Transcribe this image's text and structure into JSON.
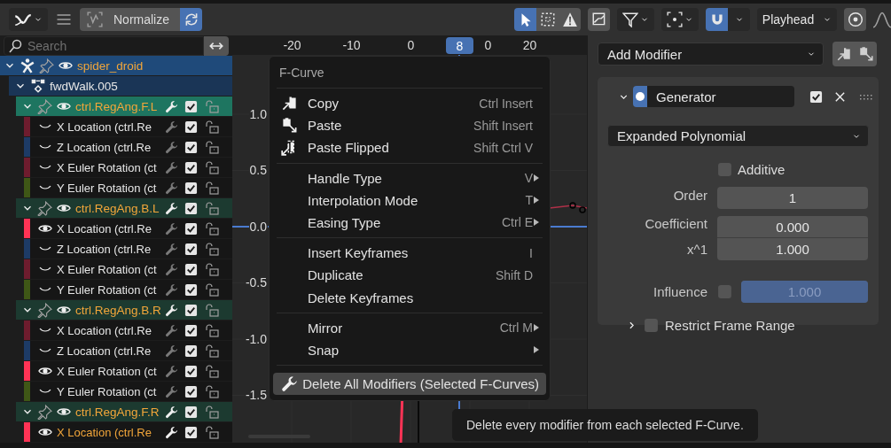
{
  "header": {
    "normalize": {
      "label": "Normalize",
      "on": false
    },
    "auto_normalize": {
      "on": true
    },
    "tools": [
      {
        "kind": "tweak",
        "selected": true
      },
      {
        "kind": "box_select",
        "selected": false
      },
      {
        "kind": "warning",
        "selected": false
      }
    ],
    "snap": {
      "on": true
    },
    "snap_target": "Playhead",
    "proportional": {
      "on": false
    }
  },
  "search": {
    "placeholder": "Search"
  },
  "channels": [
    {
      "kind": "object",
      "name": "spider_droid",
      "expanded": true,
      "selected": true,
      "visible": true,
      "children": [
        {
          "kind": "action",
          "name": "fwdWalk.005",
          "expanded": true,
          "selected": false,
          "children": [
            {
              "kind": "group",
              "name": "ctrl.RegAng.F.L",
              "expanded": true,
              "active": true,
              "selected": true,
              "visible": true,
              "enabled": true,
              "children": [
                {
                  "kind": "channel",
                  "name": "X Location (ctrl.Re",
                  "color": "#6e1c2e",
                  "visible": false,
                  "selected": false,
                  "enabled": true
                },
                {
                  "kind": "channel",
                  "name": "Z Location (ctrl.Re",
                  "color": "#1d3b66",
                  "visible": false,
                  "selected": false,
                  "enabled": true
                },
                {
                  "kind": "channel",
                  "name": "X Euler Rotation (ct",
                  "color": "#6e1c2e",
                  "visible": false,
                  "selected": false,
                  "enabled": true
                },
                {
                  "kind": "channel",
                  "name": "Y Euler Rotation (ct",
                  "color": "#3f5716",
                  "visible": false,
                  "selected": false,
                  "enabled": true
                }
              ]
            },
            {
              "kind": "group",
              "name": "ctrl.RegAng.B.L",
              "expanded": true,
              "active": false,
              "selected": true,
              "visible": true,
              "enabled": true,
              "children": [
                {
                  "kind": "channel",
                  "name": "X Location (ctrl.Re",
                  "color": "#ff3355",
                  "visible": true,
                  "selected": false,
                  "enabled": true
                },
                {
                  "kind": "channel",
                  "name": "Z Location (ctrl.Re",
                  "color": "#1d3b66",
                  "visible": false,
                  "selected": false,
                  "enabled": true
                },
                {
                  "kind": "channel",
                  "name": "X Euler Rotation (ct",
                  "color": "#6e1c2e",
                  "visible": false,
                  "selected": false,
                  "enabled": true
                },
                {
                  "kind": "channel",
                  "name": "Y Euler Rotation (ct",
                  "color": "#3f5716",
                  "visible": false,
                  "selected": false,
                  "enabled": true
                }
              ]
            },
            {
              "kind": "group",
              "name": "ctrl.RegAng.B.R",
              "expanded": true,
              "active": false,
              "selected": true,
              "visible": true,
              "enabled": true,
              "children": [
                {
                  "kind": "channel",
                  "name": "X Location (ctrl.Re",
                  "color": "#6e1c2e",
                  "visible": false,
                  "selected": false,
                  "enabled": true
                },
                {
                  "kind": "channel",
                  "name": "Z Location (ctrl.Re",
                  "color": "#1d3b66",
                  "visible": false,
                  "selected": false,
                  "enabled": true
                },
                {
                  "kind": "channel",
                  "name": "X Euler Rotation (ct",
                  "color": "#ff3355",
                  "visible": true,
                  "selected": false,
                  "enabled": true
                },
                {
                  "kind": "channel",
                  "name": "Y Euler Rotation (ct",
                  "color": "#3f5716",
                  "visible": false,
                  "selected": false,
                  "enabled": true
                }
              ]
            },
            {
              "kind": "group",
              "name": "ctrl.RegAng.F.R",
              "expanded": true,
              "active": false,
              "selected": true,
              "visible": true,
              "enabled": true,
              "children": [
                {
                  "kind": "channel",
                  "name": "X Location (ctrl.Re",
                  "color": "#ff3355",
                  "visible": true,
                  "selected": true,
                  "enabled": true
                }
              ]
            }
          ]
        }
      ]
    }
  ],
  "graph": {
    "frame_ticks": [
      {
        "kind": "tick",
        "label": "-20"
      },
      {
        "kind": "tick",
        "label": "-10"
      },
      {
        "kind": "tick",
        "label": "0"
      },
      {
        "kind": "partial",
        "label": "0"
      },
      {
        "kind": "tick",
        "label": "20"
      }
    ],
    "current_frame": "8",
    "value_ticks": [
      "1.0",
      "0.5",
      "0.0",
      "-0.5",
      "-1.0",
      "-1.5"
    ]
  },
  "context_menu": {
    "title": "F-Curve",
    "sections": [
      [
        {
          "kind": "copy",
          "label": "Copy",
          "shortcut": "Ctrl Insert",
          "submenu": false,
          "selected": false
        },
        {
          "kind": "paste",
          "label": "Paste",
          "shortcut": "Shift Insert",
          "submenu": false,
          "selected": false
        },
        {
          "kind": "paste_flipped",
          "label": "Paste Flipped",
          "shortcut": "Shift Ctrl V",
          "submenu": false,
          "selected": false
        }
      ],
      [
        {
          "kind": "plain",
          "label": "Handle Type",
          "shortcut": "V",
          "submenu": true,
          "selected": false
        },
        {
          "kind": "plain",
          "label": "Interpolation Mode",
          "shortcut": "T",
          "submenu": true,
          "selected": false
        },
        {
          "kind": "plain",
          "label": "Easing Type",
          "shortcut": "Ctrl E",
          "submenu": true,
          "selected": false
        }
      ],
      [
        {
          "kind": "plain",
          "label": "Insert Keyframes",
          "shortcut": "I",
          "submenu": false,
          "selected": false
        },
        {
          "kind": "plain",
          "label": "Duplicate",
          "shortcut": "Shift D",
          "submenu": false,
          "selected": false
        },
        {
          "kind": "plain",
          "label": "Delete Keyframes",
          "submenu": false,
          "selected": false
        }
      ],
      [
        {
          "kind": "plain",
          "label": "Mirror",
          "shortcut": "Ctrl M",
          "submenu": true,
          "selected": false
        },
        {
          "kind": "plain",
          "label": "Snap",
          "submenu": true,
          "selected": false
        }
      ],
      [
        {
          "kind": "wrench",
          "label": "Delete All Modifiers (Selected F-Curves)",
          "submenu": false,
          "selected": true
        }
      ]
    ]
  },
  "tooltip": "Delete every modifier from each selected F-Curve.",
  "sidebar": {
    "add_modifier": "Add Modifier",
    "modifier": {
      "name": "Generator",
      "expanded": true,
      "on": true,
      "enabled": true,
      "mode": "Expanded Polynomial",
      "additive": {
        "label": "Additive",
        "checked": false
      },
      "order": {
        "label": "Order",
        "value": "1"
      },
      "coefficients": [
        {
          "label": "Coefficient",
          "value": "0.000"
        },
        {
          "label": "x^1",
          "value": "1.000"
        }
      ],
      "influence": {
        "label": "Influence",
        "checked": false,
        "value": "1.000",
        "level": 1
      },
      "restrict_frame_range": {
        "label": "Restrict Frame Range",
        "expanded": false,
        "checked": false
      }
    }
  }
}
